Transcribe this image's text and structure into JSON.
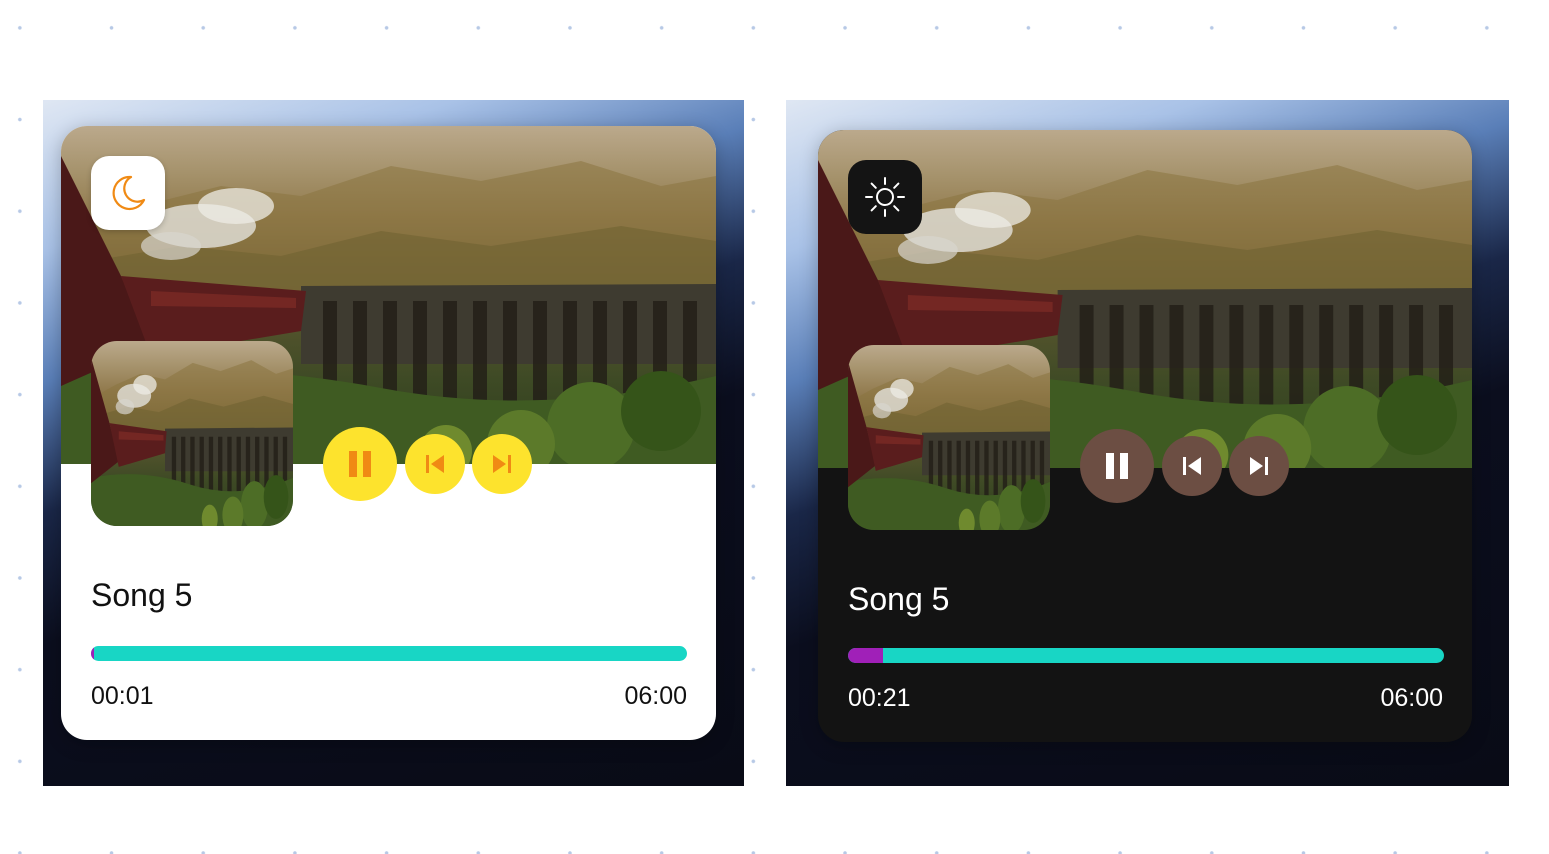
{
  "players": [
    {
      "theme": "light",
      "theme_icon": "moon-icon",
      "song_title": "Song 5",
      "current_time": "00:01",
      "total_time": "06:00",
      "progress_fraction": 0.005,
      "controls": [
        "pause-icon",
        "skip-previous-icon",
        "skip-next-icon"
      ],
      "colors": {
        "card": "#ffffff",
        "controls": "#fde32d",
        "control_icons": "#f08a14",
        "progress_track": "#18d6c5",
        "progress_fill": "#a020b8",
        "theme_icon": "#f08a14"
      }
    },
    {
      "theme": "dark",
      "theme_icon": "sun-icon",
      "song_title": "Song 5",
      "current_time": "00:21",
      "total_time": "06:00",
      "progress_fraction": 0.058,
      "controls": [
        "pause-icon",
        "skip-previous-icon",
        "skip-next-icon"
      ],
      "colors": {
        "card": "#131313",
        "controls": "#6c4e43",
        "control_icons": "#ffffff",
        "progress_track": "#18d6c5",
        "progress_fill": "#a020b8",
        "theme_icon": "#ffffff"
      }
    }
  ]
}
